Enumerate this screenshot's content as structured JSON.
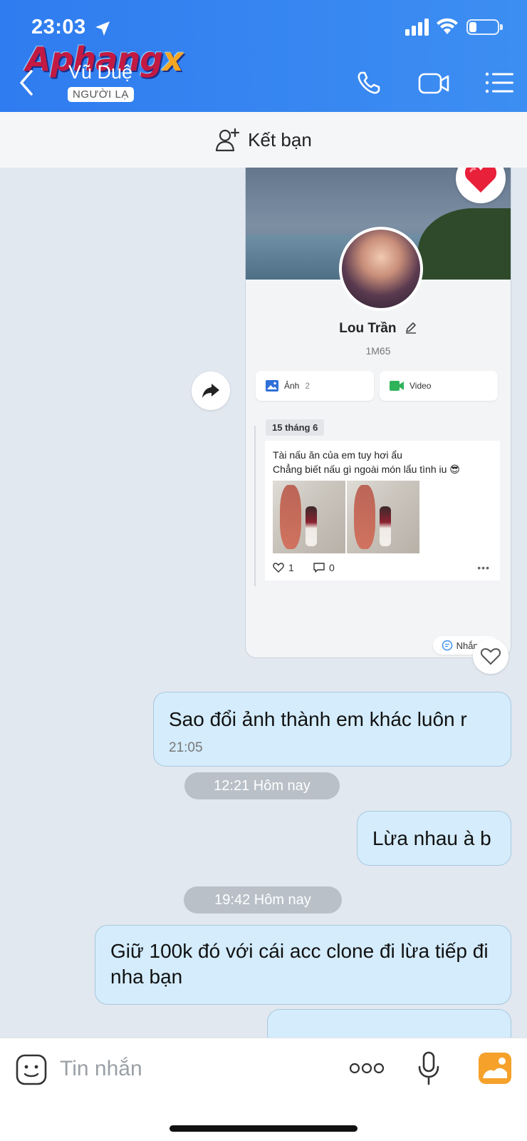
{
  "status_bar": {
    "time": "23:03",
    "battery_level": 0.25
  },
  "watermark": {
    "text_main": "Aphang",
    "text_x": "x"
  },
  "header": {
    "contact_name": "Vũ Duệ",
    "badge": "NGƯỜI LẠ",
    "icons": [
      "back-icon",
      "phone-icon",
      "video-call-icon",
      "menu-list-icon"
    ]
  },
  "friend_bar": {
    "label": "Kết bạn",
    "icon": "add-person-icon"
  },
  "profile_card": {
    "name": "Lou Trần",
    "subtitle": "1M65",
    "tabs": [
      {
        "label": "Ảnh",
        "count": "2",
        "icon": "image-icon"
      },
      {
        "label": "Video",
        "count": "",
        "icon": "video-icon"
      }
    ],
    "date_label": "15 tháng 6",
    "post_line_1": "Tài nấu ăn của em tuy hơi ẩu",
    "post_line_2": "Chẳng biết nấu gì ngoài món lẩu tình iu 😎",
    "likes": "1",
    "comments": "0",
    "message_button": "Nhắn tin"
  },
  "messages": [
    {
      "text": "Sao đổi ảnh thành em khác luôn r",
      "time": "21:05"
    },
    {
      "separator": "12:21 Hôm nay"
    },
    {
      "text": "Lừa nhau à b"
    },
    {
      "separator": "19:42 Hôm nay"
    },
    {
      "text": "Giữ 100k đó với cái acc clone đi lừa tiếp đi nha bạn"
    }
  ],
  "input_bar": {
    "placeholder": "Tin nhắn"
  },
  "colors": {
    "header_blue": "#3d8ef2",
    "bubble": "#d4ecfc",
    "heart": "#e8203a",
    "gallery": "#f5a12a"
  }
}
